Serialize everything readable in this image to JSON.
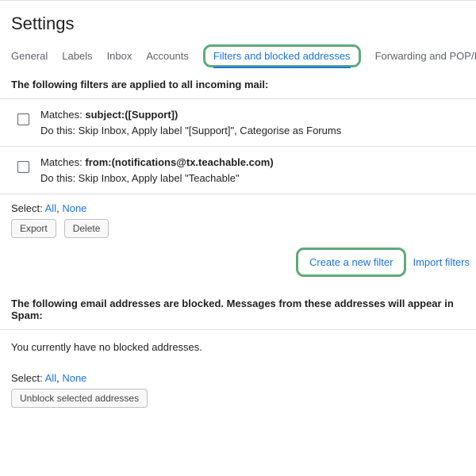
{
  "pageTitle": "Settings",
  "tabs": {
    "general": "General",
    "labels": "Labels",
    "inbox": "Inbox",
    "accounts": "Accounts",
    "filters": "Filters and blocked addresses",
    "forwarding": "Forwarding and POP/IMAP"
  },
  "filtersSectionHeader": "The following filters are applied to all incoming mail:",
  "filters": [
    {
      "matchesLabel": "Matches: ",
      "matchesValue": "subject:([Support])",
      "doThis": "Do this: Skip Inbox, Apply label \"[Support]\", Categorise as Forums"
    },
    {
      "matchesLabel": "Matches: ",
      "matchesValue": "from:(notifications@tx.teachable.com)",
      "doThis": "Do this: Skip Inbox, Apply label \"Teachable\""
    }
  ],
  "select": {
    "label": "Select: ",
    "all": "All",
    "comma": ", ",
    "none": "None"
  },
  "buttons": {
    "export": "Export",
    "delete": "Delete"
  },
  "actions": {
    "createFilter": "Create a new filter",
    "importFilters": "Import filters"
  },
  "blockedSectionHeader": "The following email addresses are blocked. Messages from these addresses will appear in Spam:",
  "blockedEmpty": "You currently have no blocked addresses.",
  "unblockButton": "Unblock selected addresses"
}
